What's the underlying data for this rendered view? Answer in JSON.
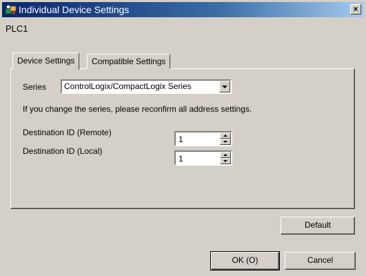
{
  "window": {
    "title": "Individual Device Settings",
    "close_glyph": "×",
    "icon": "device-settings-icon"
  },
  "device_name": "PLC1",
  "tabs": [
    {
      "label": "Device Settings",
      "active": true
    },
    {
      "label": "Compatible Settings",
      "active": false
    }
  ],
  "device_settings": {
    "series_label": "Series",
    "series_value": "ControlLogix/CompactLogix Series",
    "note": "If you change the series, please reconfirm all address settings.",
    "dest_remote_label": "Destination ID (Remote)",
    "dest_remote_value": "1",
    "dest_local_label": "Destination ID (Local)",
    "dest_local_value": "1"
  },
  "buttons": {
    "default_label": "Default",
    "ok_label": "OK (O)",
    "cancel_label": "Cancel"
  },
  "colors": {
    "titlebar_start": "#0a246a",
    "titlebar_end": "#a6caf0",
    "face": "#d4d0c8"
  }
}
